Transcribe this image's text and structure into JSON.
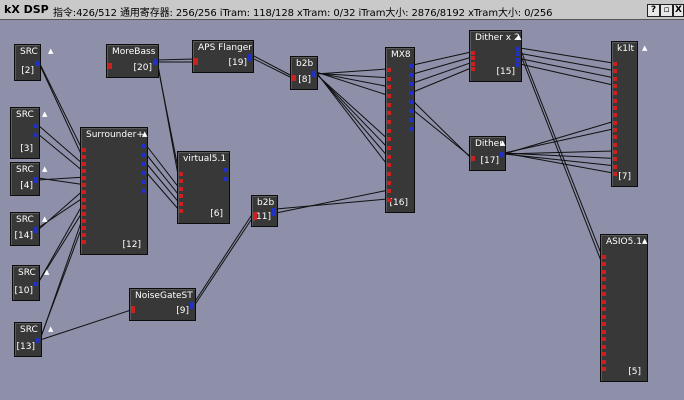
{
  "window": {
    "title": "kX DSP",
    "status": "指令:426/512 通用寄存器: 256/256 iTram: 118/128 xTram: 0/32 iTram大小: 2876/8192 xTram大小: 0/256",
    "buttons": [
      "?",
      "▫",
      "X"
    ]
  },
  "nodes": [
    {
      "name": "src-2",
      "label": "SRC",
      "index": "[2]"
    },
    {
      "name": "src-3",
      "label": "SRC",
      "index": "[3]"
    },
    {
      "name": "src-4",
      "label": "SRC",
      "index": "[4]"
    },
    {
      "name": "src-14",
      "label": "SRC",
      "index": "[14]"
    },
    {
      "name": "src-10",
      "label": "SRC",
      "index": "[10]"
    },
    {
      "name": "src-13",
      "label": "SRC",
      "index": "[13]"
    },
    {
      "name": "morebass",
      "label": "MoreBass",
      "index": "[20]"
    },
    {
      "name": "aps-flanger",
      "label": "APS Flanger",
      "index": "[19]"
    },
    {
      "name": "b2b-8",
      "label": "b2b",
      "index": "[8]"
    },
    {
      "name": "mx8",
      "label": "MX8",
      "index": "[16]"
    },
    {
      "name": "dither-x2",
      "label": "Dither x 2",
      "index": "[15]"
    },
    {
      "name": "k1lt",
      "label": "k1lt",
      "index": "[7]"
    },
    {
      "name": "surrounder",
      "label": "Surrounder+",
      "index": "[12]"
    },
    {
      "name": "virtual51",
      "label": "virtual5.1",
      "index": "[6]"
    },
    {
      "name": "dither-17",
      "label": "Dither",
      "index": "[17]"
    },
    {
      "name": "b2b-11",
      "label": "b2b",
      "index": "[11]"
    },
    {
      "name": "noisegate",
      "label": "NoiseGateST",
      "index": "[9]"
    },
    {
      "name": "asio51",
      "label": "ASIO5.1",
      "index": "[5]"
    }
  ]
}
